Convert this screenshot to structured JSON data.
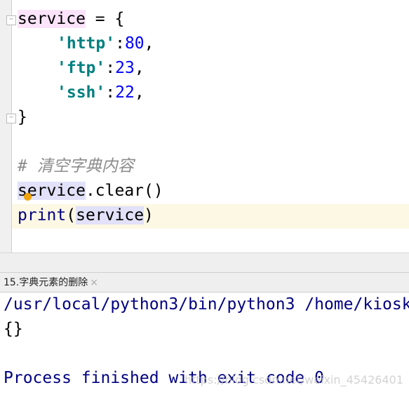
{
  "editor": {
    "lines": {
      "l1": {
        "var": "service",
        "rest": " = {"
      },
      "l2": {
        "key": "'http'",
        "colon": ":",
        "val": "80",
        "comma": ","
      },
      "l3": {
        "key": "'ftp'",
        "colon": ":",
        "val": "23",
        "comma": ","
      },
      "l4": {
        "key": "'ssh'",
        "colon": ":",
        "val": "22",
        "comma": ","
      },
      "l5": {
        "text": "}"
      },
      "l7": {
        "text": "# 清空字典内容"
      },
      "l8": {
        "var": "service",
        "rest": ".clear()"
      },
      "l9": {
        "fn": "print",
        "open": "(",
        "var": "service",
        "close": ")"
      }
    }
  },
  "run_tab": {
    "label": "15.字典元素的删除",
    "close": "×"
  },
  "output": {
    "lines": [
      "/usr/local/python3/bin/python3 /home/kiosk",
      "{}",
      "",
      "Process finished with exit code 0"
    ]
  },
  "watermark": "https://blog.csdn.net/weixin_45426401",
  "colors": {
    "string": "#008080",
    "number": "#0000ff",
    "keyword": "#000080",
    "comment": "#8c8c8c",
    "output": "#000080"
  }
}
